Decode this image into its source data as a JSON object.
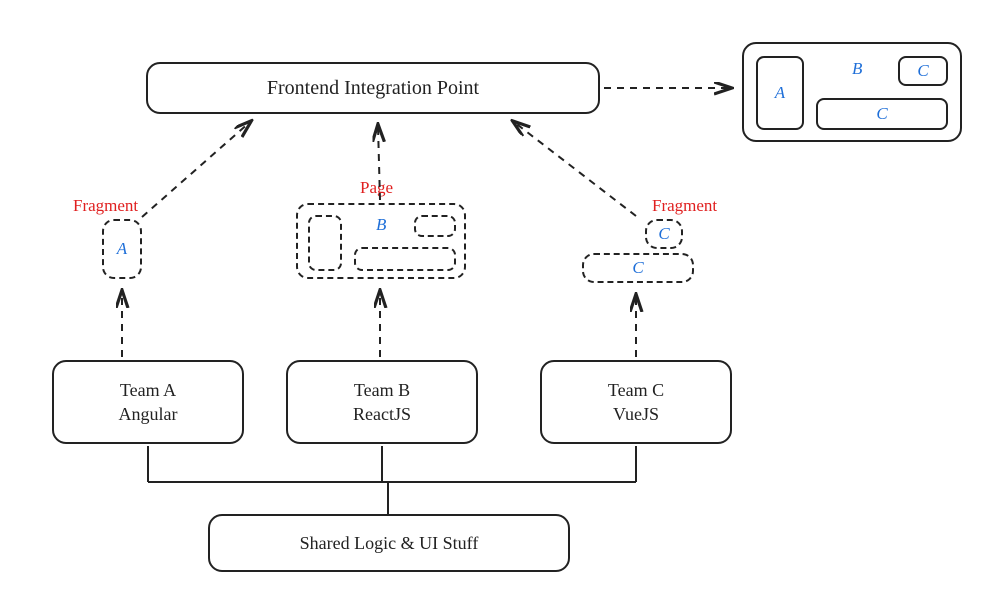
{
  "integration": {
    "title": "Frontend Integration Point"
  },
  "artifacts": {
    "fragment_a_label": "Fragment",
    "fragment_a_letter": "A",
    "page_label": "Page",
    "page_letter": "B",
    "fragment_c_label": "Fragment",
    "fragment_c_letter_top": "C",
    "fragment_c_letter_bottom": "C"
  },
  "teams": {
    "a": {
      "name": "Team A",
      "tech": "Angular"
    },
    "b": {
      "name": "Team B",
      "tech": "ReactJS"
    },
    "c": {
      "name": "Team C",
      "tech": "VueJS"
    }
  },
  "shared": {
    "label": "Shared Logic & UI Stuff"
  },
  "result": {
    "a": "A",
    "b": "B",
    "c1": "C",
    "c2": "C"
  }
}
